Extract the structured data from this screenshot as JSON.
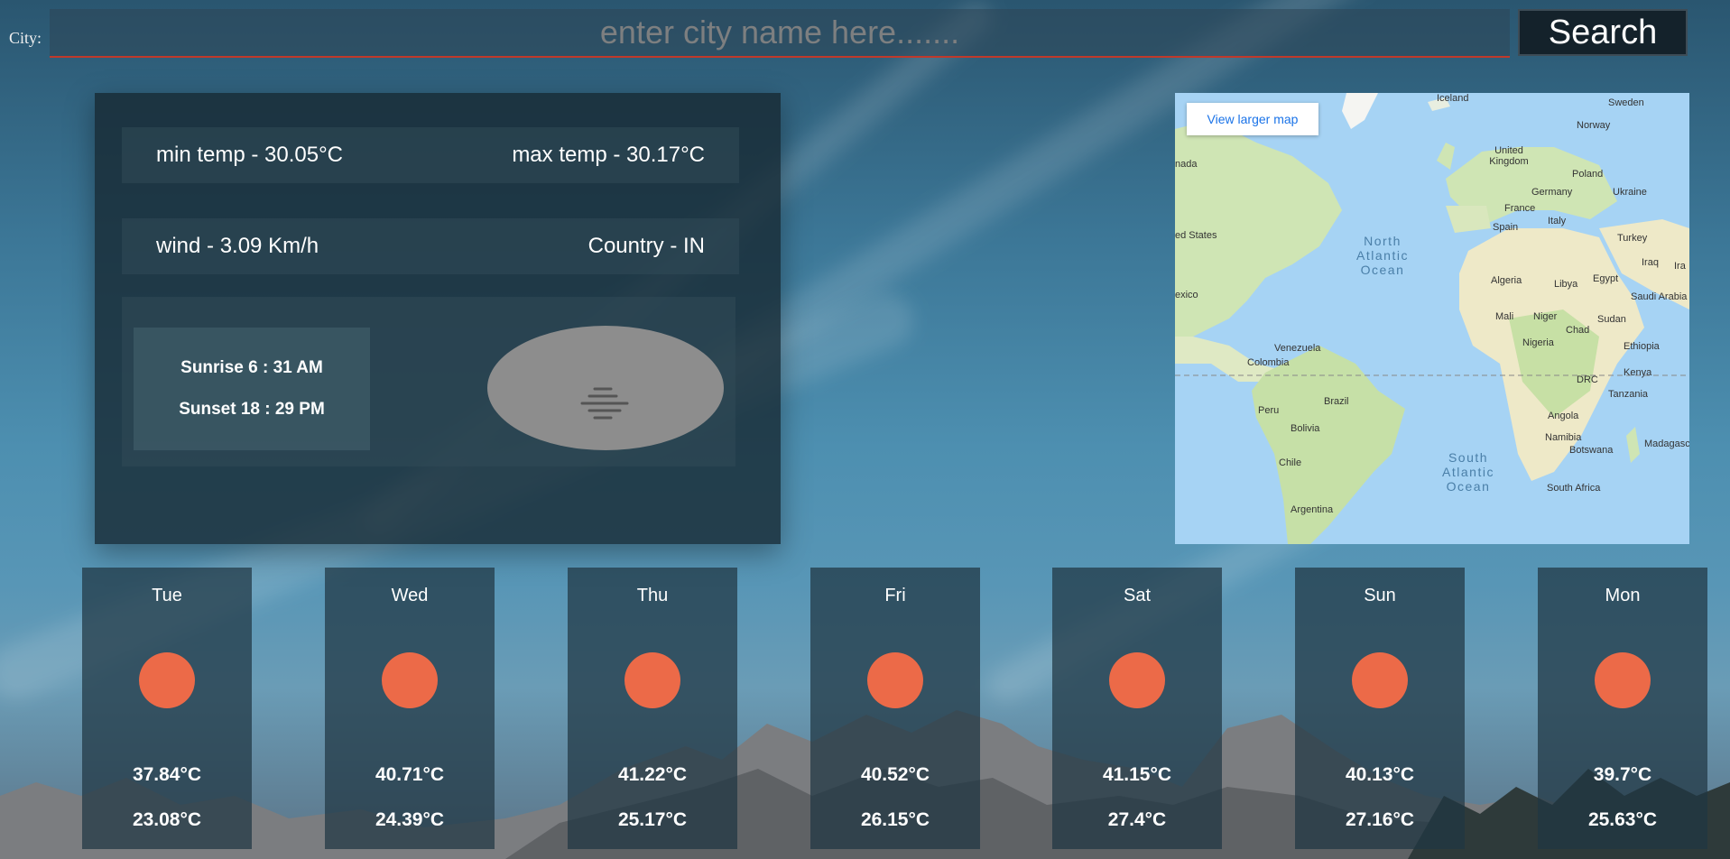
{
  "search": {
    "city_label": "City:",
    "placeholder": "enter city name here.......",
    "button_label": "Search"
  },
  "weather": {
    "min_temp": "min temp - 30.05°C",
    "max_temp": "max temp - 30.17°C",
    "wind": "wind - 3.09 Km/h",
    "country": "Country - IN",
    "sunrise": "Sunrise 6 : 31 AM",
    "sunset": "Sunset 18 : 29 PM",
    "condition_icon": "mist-icon"
  },
  "map": {
    "link_label": "View larger map",
    "labels": {
      "iceland": "Iceland",
      "sweden": "Sweden",
      "norway": "Norway",
      "uk": "United Kingdom",
      "poland": "Poland",
      "germany": "Germany",
      "ukraine": "Ukraine",
      "france": "France",
      "spain": "Spain",
      "italy": "Italy",
      "turkey": "Turkey",
      "iraq": "Iraq",
      "ira": "Ira",
      "canada": "nada",
      "us": "ed States",
      "mexico": "exico",
      "north_atlantic": "North Atlantic Ocean",
      "south_atlantic": "South Atlantic Ocean",
      "algeria": "Algeria",
      "libya": "Libya",
      "egypt": "Egypt",
      "saudi": "Saudi Arabia",
      "mali": "Mali",
      "niger": "Niger",
      "chad": "Chad",
      "sudan": "Sudan",
      "nigeria": "Nigeria",
      "ethiopia": "Ethiopia",
      "venezuela": "Venezuela",
      "colombia": "Colombia",
      "drc": "DRC",
      "kenya": "Kenya",
      "tanzania": "Tanzania",
      "brazil": "Brazil",
      "peru": "Peru",
      "bolivia": "Bolivia",
      "angola": "Angola",
      "namibia": "Namibia",
      "botswana": "Botswana",
      "madagascar": "Madagasca",
      "chile": "Chile",
      "south_africa": "South Africa",
      "argentina": "Argentina"
    }
  },
  "forecast": [
    {
      "day": "Tue",
      "max": "37.84°C",
      "min": "23.08°C",
      "icon": "sun-icon"
    },
    {
      "day": "Wed",
      "max": "40.71°C",
      "min": "24.39°C",
      "icon": "sun-icon"
    },
    {
      "day": "Thu",
      "max": "41.22°C",
      "min": "25.17°C",
      "icon": "sun-icon"
    },
    {
      "day": "Fri",
      "max": "40.52°C",
      "min": "26.15°C",
      "icon": "sun-icon"
    },
    {
      "day": "Sat",
      "max": "41.15°C",
      "min": "27.4°C",
      "icon": "sun-icon"
    },
    {
      "day": "Sun",
      "max": "40.13°C",
      "min": "27.16°C",
      "icon": "sun-icon"
    },
    {
      "day": "Mon",
      "max": "39.7°C",
      "min": "25.63°C",
      "icon": "sun-icon"
    }
  ],
  "colors": {
    "accent_underline": "#c0392b",
    "sun_icon": "#ec6a48",
    "panel_bg": "#162630"
  }
}
